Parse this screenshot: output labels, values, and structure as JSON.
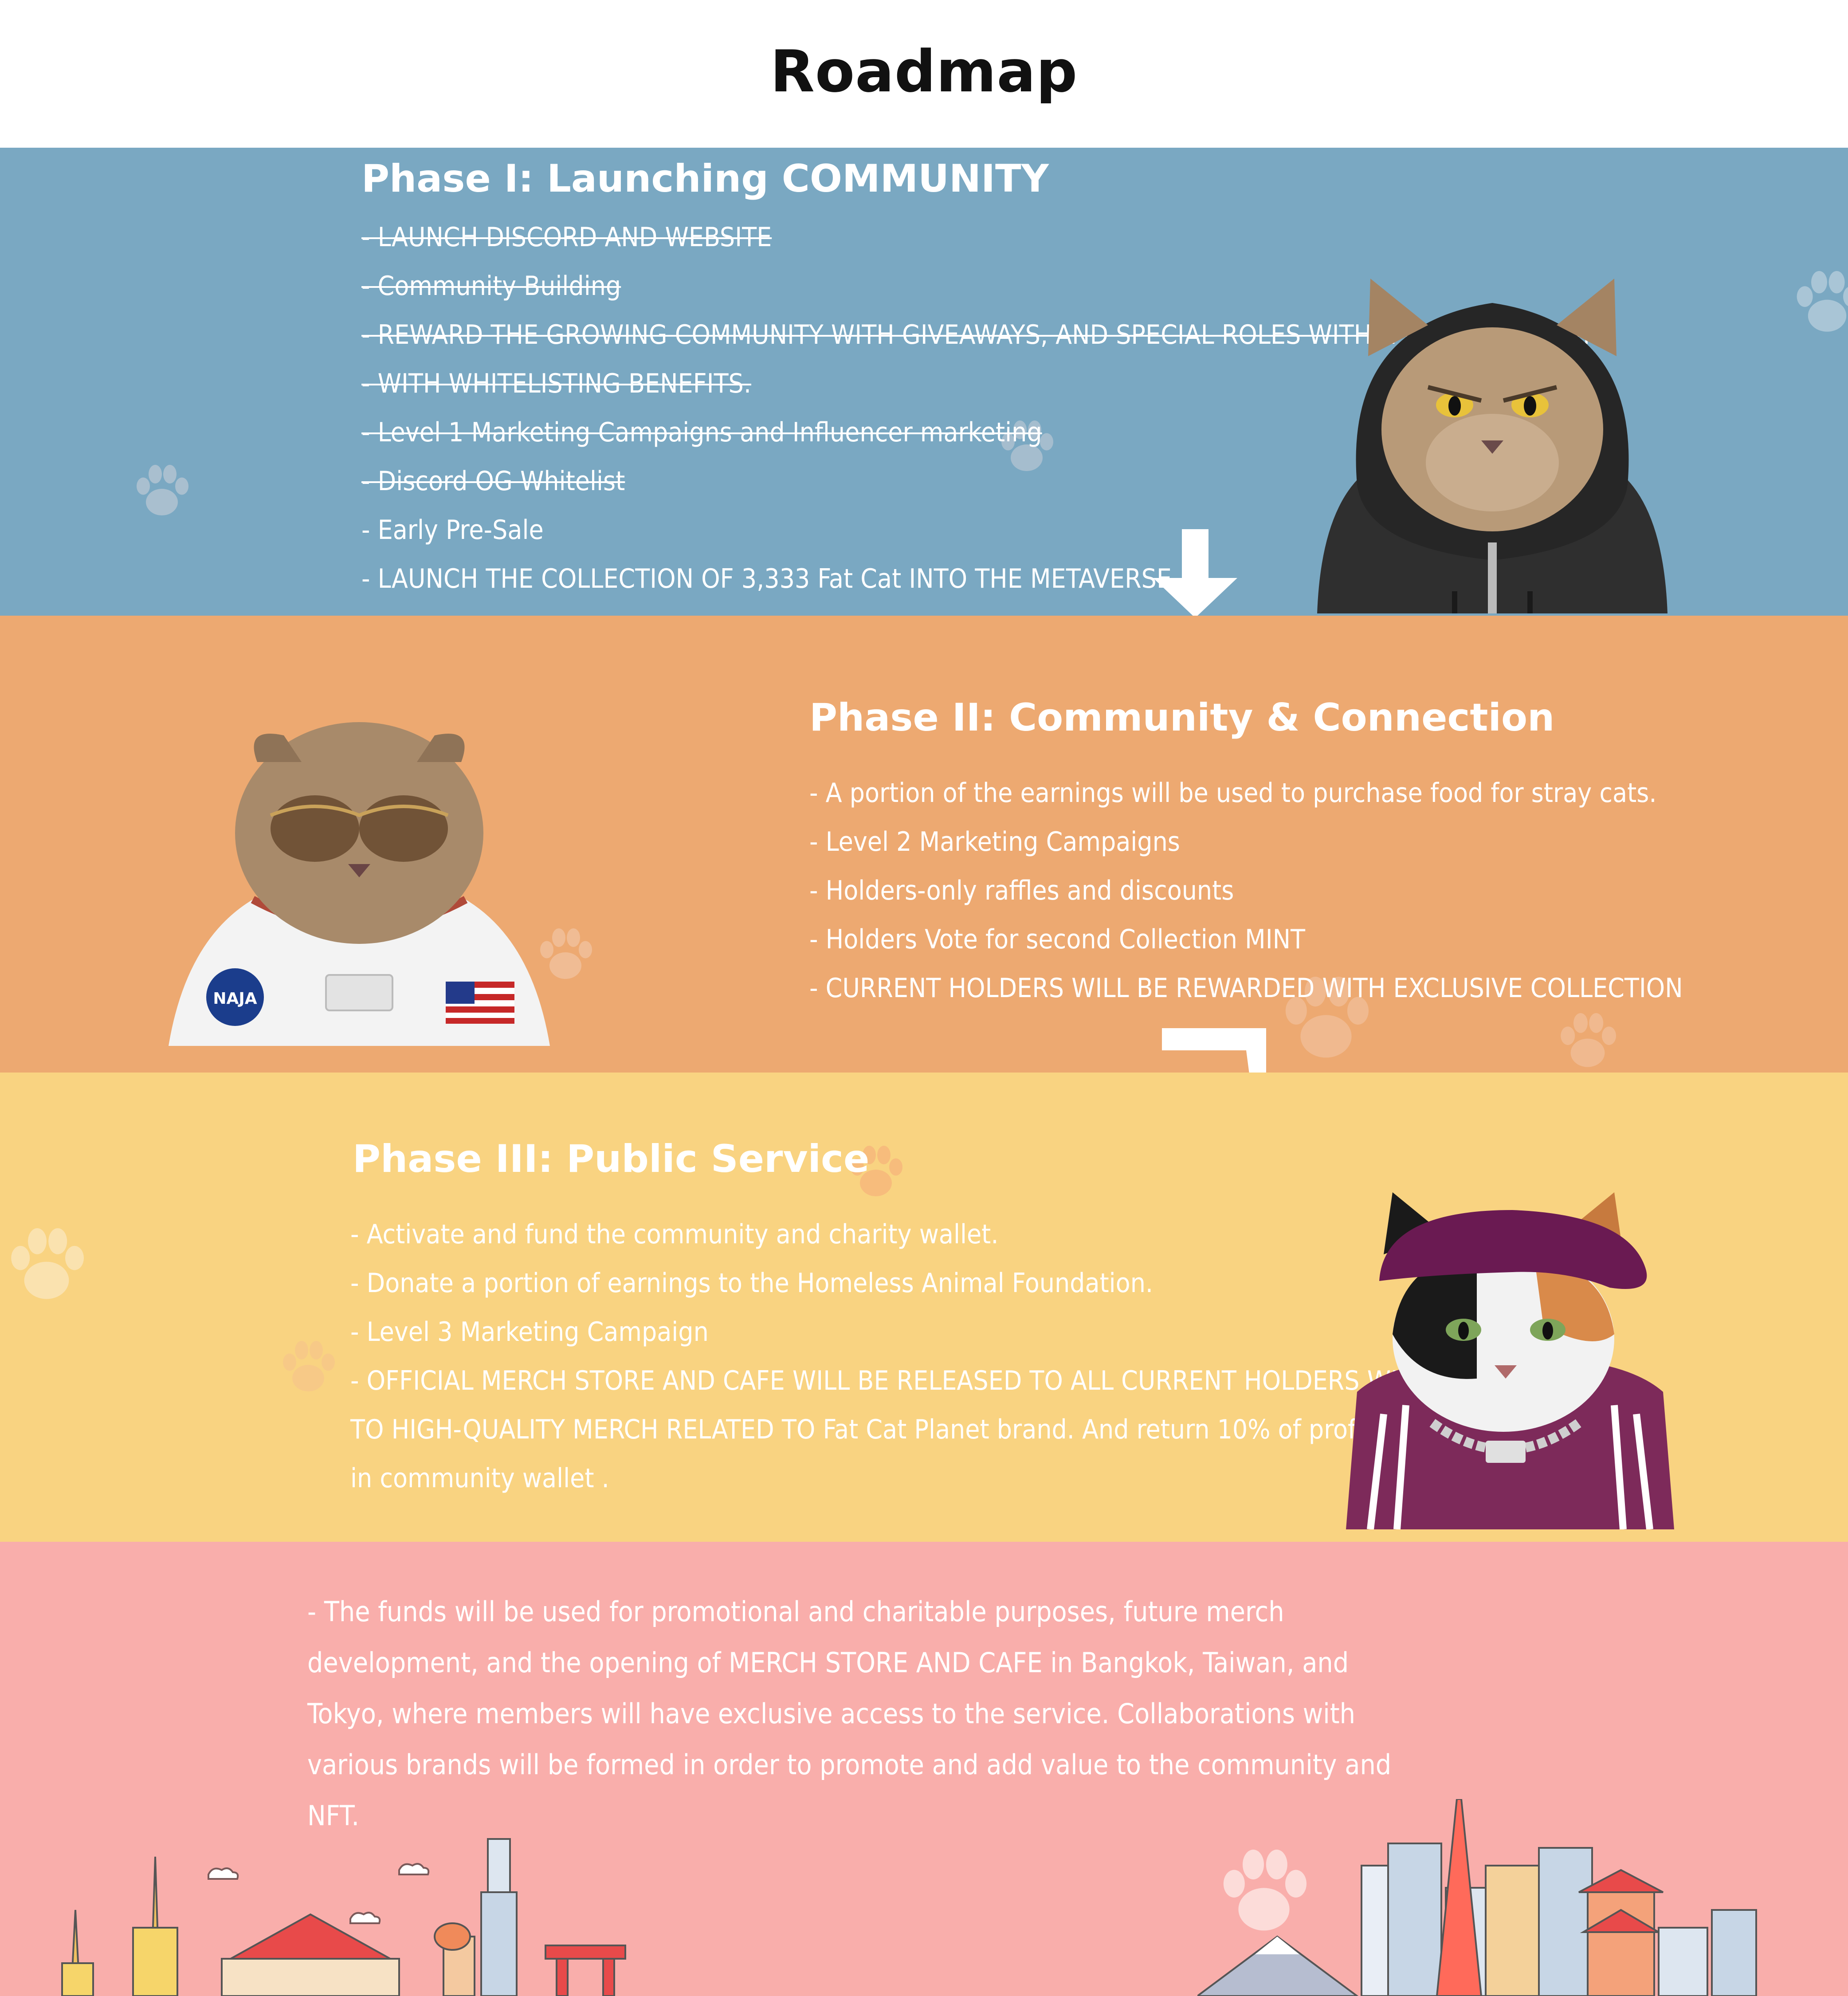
{
  "header": {
    "title": "Roadmap"
  },
  "phase1": {
    "title": "Phase I: Launching COMMUNITY",
    "items": [
      "- LAUNCH DISCORD AND WEBSITE",
      "- Community Building",
      "- REWARD THE GROWING COMMUNITY WITH GIVEAWAYS, AND SPECIAL ROLES WITHIN THE COMMUNITY",
      "- WITH WHITELISTING BENEFITS.",
      "- Level 1 Marketing Campaigns and Influencer marketing",
      "- Discord OG Whitelist",
      "- Early Pre-Sale",
      "- LAUNCH THE COLLECTION OF 3,333 Fat Cat  INTO THE METAVERSE"
    ]
  },
  "phase2": {
    "title": "Phase II: Community & Connection",
    "items": [
      "- A portion of the earnings will be used to purchase food for stray cats.",
      "- Level 2 Marketing Campaigns",
      "- Holders-only raffles and discounts",
      "- Holders Vote for second Collection MINT",
      "- CURRENT HOLDERS WILL BE REWARDED WITH EXCLUSIVE COLLECTION"
    ]
  },
  "phase3": {
    "title": "Phase III:  Public Service",
    "items": [
      "- Activate and fund the community and charity wallet.",
      "- Donate a portion of earnings to the Homeless Animal Foundation.",
      "- Level 3 Marketing Campaign",
      "- OFFICIAL MERCH STORE AND CAFE WILL BE RELEASED TO ALL CURRENT HOLDERS WITH ACCESS",
      "TO HIGH-QUALITY MERCH RELATED TO Fat Cat Planet brand. And return 10% of profits to holders",
      "in community wallet ."
    ]
  },
  "phase4": {
    "text": "- The funds will be used for promotional and charitable purposes, future merch development, and the opening of MERCH STORE AND CAFE in Bangkok, Taiwan, and Tokyo, where members will have exclusive access to the service. Collaborations with various brands will be formed in order to promote and add value to the community and NFT."
  },
  "badges": {
    "patch": "NAJA"
  },
  "colors": {
    "phase1_bg": "#7aa8c2",
    "phase2_bg": "#eda971",
    "phase3_bg": "#f9d381",
    "phase4_bg": "#f9aeab",
    "text": "#ffffff",
    "title": "#111111"
  },
  "icons": [
    "paw-icon",
    "down-arrow-icon",
    "hooded-cat-illustration",
    "astronaut-cat-illustration",
    "rapper-cat-illustration",
    "bangkok-skyline-illustration",
    "tokyo-skyline-illustration"
  ]
}
